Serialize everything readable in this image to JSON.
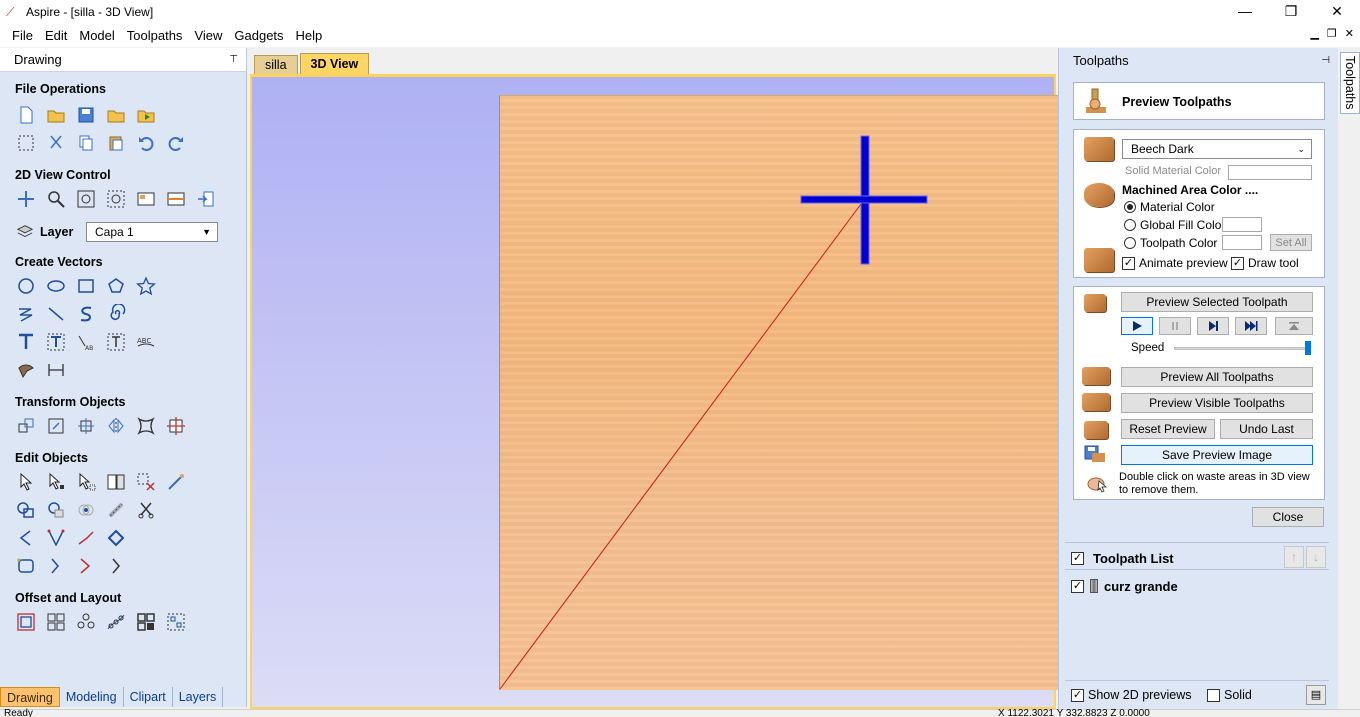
{
  "window": {
    "title": "Aspire - [silla - 3D View]",
    "minimize": "—",
    "maximize": "❐",
    "close": "✕"
  },
  "menu": [
    "File",
    "Edit",
    "Model",
    "Toolpaths",
    "View",
    "Gadgets",
    "Help"
  ],
  "drawing_panel": {
    "header": "Drawing",
    "pin": "⊤",
    "sections": {
      "file_operations": "File Operations",
      "view_control": "2D View Control",
      "create_vectors": "Create Vectors",
      "transform_objects": "Transform Objects",
      "edit_objects": "Edit Objects",
      "offset_layout": "Offset and Layout"
    },
    "layer": {
      "label": "Layer",
      "value": "Capa 1"
    },
    "bottom_tabs": [
      "Drawing",
      "Modeling",
      "Clipart",
      "Layers"
    ]
  },
  "doc_tabs": [
    "silla",
    "3D View"
  ],
  "toolpaths_panel": {
    "header": "Toolpaths",
    "side_tab": "Toolpaths",
    "title": "Preview Toolpaths",
    "material": "Beech Dark",
    "solid_material_color": "Solid Material Color",
    "machined_area_color": "Machined Area Color ....",
    "radio_material_color": "Material Color",
    "radio_global_fill": "Global Fill Color",
    "radio_toolpath_color": "Toolpath Color",
    "set_all": "Set All",
    "animate_preview": "Animate preview",
    "draw_tool": "Draw tool",
    "preview_selected": "Preview Selected Toolpath",
    "speed": "Speed",
    "preview_all": "Preview All Toolpaths",
    "preview_visible": "Preview Visible Toolpaths",
    "reset_preview": "Reset Preview",
    "undo_last": "Undo Last",
    "save_preview_image": "Save Preview Image",
    "hint": "Double click on waste areas in 3D view to remove them.",
    "close": "Close",
    "toolpath_list": "Toolpath List",
    "toolpath_item": "curz grande",
    "show_2d_previews": "Show 2D previews",
    "solid": "Solid"
  },
  "status": {
    "text": "Ready",
    "coords": "X 1122.3021 Y 332.8823 Z 0.0000"
  },
  "colors": {
    "accent": "#0000cc",
    "tab_active": "#ffc16e",
    "viewport_border": "#ffd25a"
  }
}
